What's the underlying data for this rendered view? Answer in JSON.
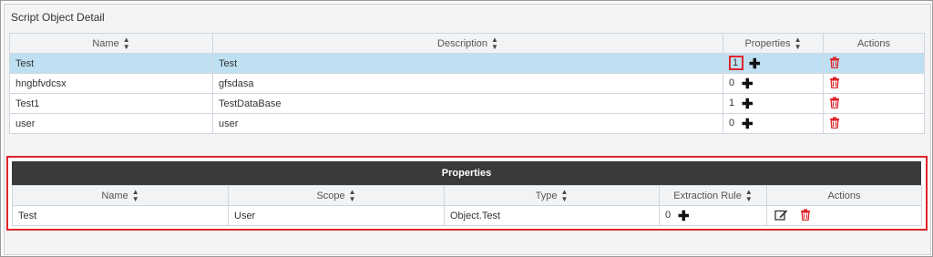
{
  "panel": {
    "title": "Script Object Detail"
  },
  "objects_table": {
    "headers": {
      "name": "Name",
      "description": "Description",
      "properties": "Properties",
      "actions": "Actions"
    },
    "rows": [
      {
        "name": "Test",
        "description": "Test",
        "count": "1",
        "selected": true
      },
      {
        "name": "hngbfvdcsx",
        "description": "gfsdasa",
        "count": "0"
      },
      {
        "name": "Test1",
        "description": "TestDataBase",
        "count": "1"
      },
      {
        "name": "user",
        "description": "user",
        "count": "0"
      }
    ]
  },
  "properties_table": {
    "title": "Properties",
    "headers": {
      "name": "Name",
      "scope": "Scope",
      "type": "Type",
      "extraction_rule": "Extraction Rule",
      "actions": "Actions"
    },
    "rows": [
      {
        "name": "Test",
        "scope": "User",
        "type": "Object.Test",
        "extraction_count": "0"
      }
    ]
  },
  "icons": {
    "sort": "sort-icon",
    "add": "plus-icon",
    "delete": "trash-icon",
    "edit": "edit-icon"
  },
  "colors": {
    "accent_red": "#e0252b",
    "selected_row": "#bfe0f2",
    "header_dark": "#3a3a3a"
  }
}
